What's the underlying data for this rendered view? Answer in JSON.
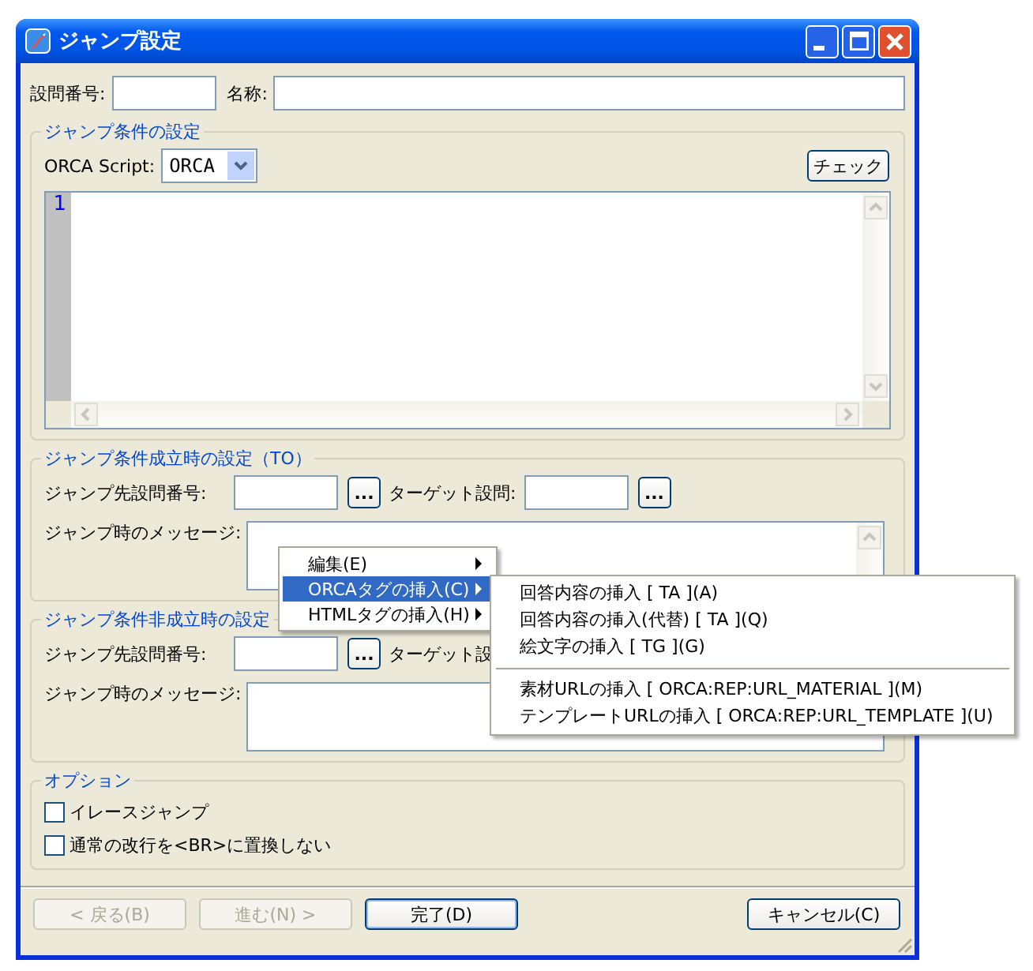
{
  "window": {
    "title": "ジャンプ設定"
  },
  "header": {
    "question_no_label": "設問番号:",
    "name_label": "名称:"
  },
  "condition": {
    "legend": "ジャンプ条件の設定",
    "script_label": "ORCA Script:",
    "script_value": "ORCA",
    "check_button": "チェック",
    "line_numbers": [
      "1"
    ]
  },
  "to_section": {
    "legend": "ジャンプ条件成立時の設定（TO）",
    "dest_label": "ジャンプ先設問番号:",
    "browse_button": "...",
    "target_label": "ターゲット設問:",
    "target_browse_button": "...",
    "message_label": "ジャンプ時のメッセージ:"
  },
  "else_section": {
    "legend": "ジャンプ条件非成立時の設定",
    "dest_label": "ジャンプ先設問番号:",
    "browse_button": "...",
    "target_label": "ターゲット設",
    "message_label": "ジャンプ時のメッセージ:"
  },
  "options": {
    "legend": "オプション",
    "items": [
      {
        "label": "イレースジャンプ",
        "checked": false
      },
      {
        "label": "通常の改行を<BR>に置換しない",
        "checked": false
      }
    ]
  },
  "buttons": [
    {
      "label": "< 戻る(B)",
      "disabled": true,
      "default": false
    },
    {
      "label": "進む(N) >",
      "disabled": true,
      "default": false
    },
    {
      "label": "完了(D)",
      "disabled": false,
      "default": true
    },
    {
      "label": "キャンセル(C)",
      "disabled": false,
      "default": false
    }
  ],
  "context_menu": {
    "items": [
      {
        "label": "編集(E)",
        "selected": false
      },
      {
        "label": "ORCAタグの挿入(C)",
        "selected": true
      },
      {
        "label": "HTMLタグの挿入(H)",
        "selected": false
      }
    ]
  },
  "submenu": {
    "items": [
      {
        "kind": "item",
        "label": "回答内容の挿入 [ TA ](A)"
      },
      {
        "kind": "item",
        "label": "回答内容の挿入(代替) [ TA ](Q)"
      },
      {
        "kind": "item",
        "label": "絵文字の挿入 [ TG ](G)"
      },
      {
        "kind": "separator"
      },
      {
        "kind": "item",
        "label": "素材URLの挿入 [ ORCA:REP:URL_MATERIAL ](M)"
      },
      {
        "kind": "item",
        "label": "テンプレートURLの挿入 [ ORCA:REP:URL_TEMPLATE ](U)"
      }
    ]
  }
}
